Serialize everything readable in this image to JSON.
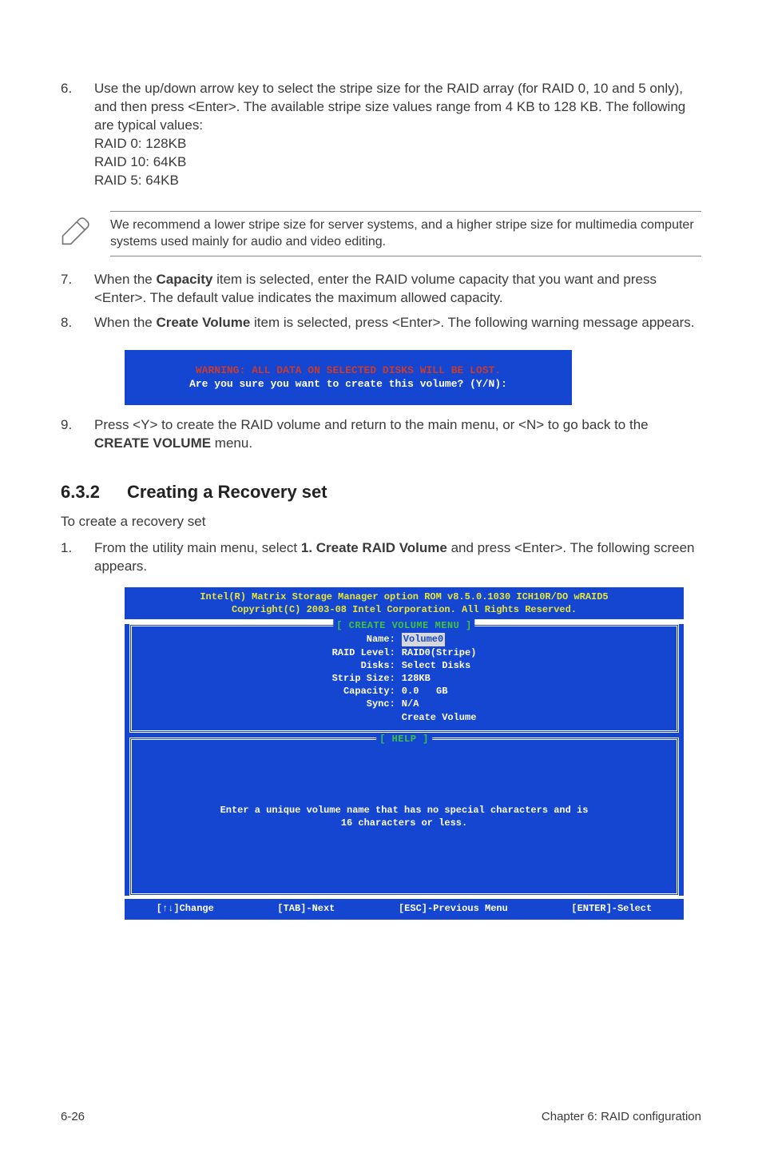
{
  "step6": {
    "num": "6.",
    "text_l1": "Use the up/down arrow key to select the stripe size for the RAID array (for RAID 0, 10 and 5 only), and then press <Enter>. The available stripe size values range from 4 KB to 128 KB. The following are typical values:",
    "l2": "RAID 0: 128KB",
    "l3": "RAID 10: 64KB",
    "l4": "RAID 5: 64KB"
  },
  "note": {
    "text": "We recommend a lower stripe size for server systems, and a higher stripe size for multimedia computer systems used mainly for audio and video editing."
  },
  "step7": {
    "num": "7.",
    "pre": "When the ",
    "bold": "Capacity",
    "post": " item is selected, enter the RAID volume capacity that you want and press <Enter>. The default value indicates the maximum allowed capacity."
  },
  "step8": {
    "num": "8.",
    "pre": "When the ",
    "bold": "Create Volume",
    "post": " item is selected, press <Enter>. The following warning message appears."
  },
  "warnbox": {
    "line1": "WARNING: ALL DATA ON SELECTED DISKS WILL BE LOST.",
    "line2": "Are you sure you want to create this volume? (Y/N):"
  },
  "step9": {
    "num": "9.",
    "pre": "Press <Y> to create the RAID volume and return to the main menu, or <N> to go back to the ",
    "bold": "CREATE VOLUME",
    "post": " menu."
  },
  "heading": {
    "num": "6.3.2",
    "title": "Creating a Recovery set"
  },
  "intro": "To create a recovery set",
  "step1": {
    "num": "1.",
    "pre": "From the utility main menu, select ",
    "bold": "1. Create RAID Volume",
    "post": " and press <Enter>. The following screen appears."
  },
  "bios": {
    "header_l1": "Intel(R) Matrix Storage Manager option ROM v8.5.0.1030 ICH10R/DO wRAID5",
    "header_l2": "Copyright(C) 2003-08 Intel Corporation.  All Rights Reserved.",
    "menu_title": "[ CREATE VOLUME MENU ]",
    "labels": {
      "name": "Name:",
      "raid_level": "RAID Level:",
      "disks": "Disks:",
      "strip_size": "Strip Size:",
      "capacity": "Capacity:",
      "sync": "Sync:"
    },
    "values": {
      "name": "Volume0",
      "raid_level": "RAID0(Stripe)",
      "disks": "Select Disks",
      "strip_size": "128KB",
      "capacity": "0.0   GB",
      "sync": "N/A",
      "create": "Create Volume"
    },
    "help_title": "[ HELP ]",
    "help_l1": "Enter a unique volume name that has no special characters and is",
    "help_l2": "16 characters or less.",
    "footer": {
      "change": "[↑↓]Change",
      "next": "[TAB]-Next",
      "prev": "[ESC]-Previous Menu",
      "select": "[ENTER]-Select"
    }
  },
  "footer": {
    "left": "6-26",
    "right": "Chapter 6: RAID configuration"
  }
}
